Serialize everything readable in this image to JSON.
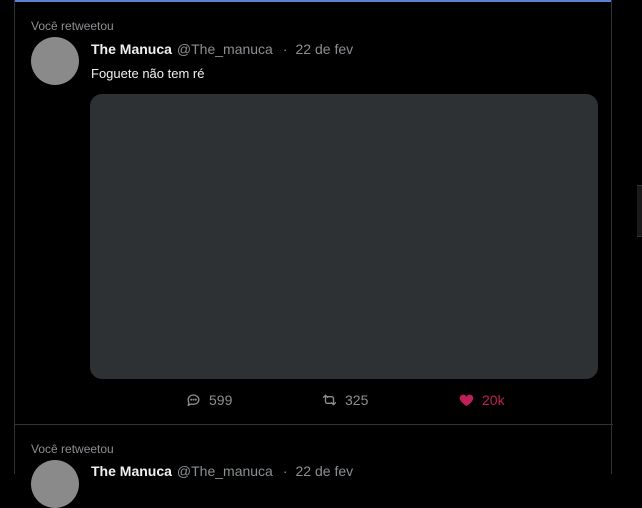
{
  "timeline": {
    "tweets": [
      {
        "retweet_label": "Você retweetou",
        "author_name": "The Manuca",
        "author_handle": "@The_manuca",
        "separator": "·",
        "date": "22 de fev",
        "text": "Foguete não tem ré",
        "reply_count": "599",
        "retweet_count": "325",
        "like_count": "20k",
        "liked": true
      },
      {
        "retweet_label": "Você retweetou",
        "author_name": "The Manuca",
        "author_handle": "@The_manuca",
        "separator": "·",
        "date": "22 de fev"
      }
    ]
  },
  "colors": {
    "background": "#000000",
    "accent_top": "#5b7fd1",
    "like_active": "#c01f5b",
    "secondary_text": "#8b8f93",
    "media_placeholder": "#2d3134"
  },
  "icons": {
    "reply": "speech-bubble-icon",
    "retweet": "retweet-arrows-icon",
    "like": "heart-filled-icon"
  }
}
